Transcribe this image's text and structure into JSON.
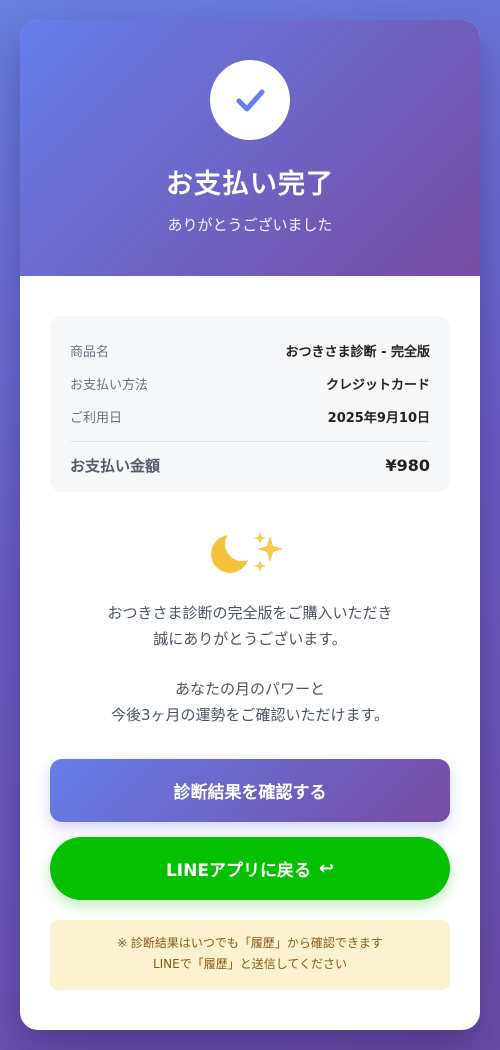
{
  "header": {
    "title": "お支払い完了",
    "subtitle": "ありがとうございました",
    "icon": "check-icon",
    "accent_color": "#667eea"
  },
  "summary": {
    "rows": [
      {
        "label": "商品名",
        "value": "おつきさま診断 - 完全版"
      },
      {
        "label": "お支払い方法",
        "value": "クレジットカード"
      },
      {
        "label": "ご利用日",
        "value": "2025年9月10日"
      }
    ],
    "total_label": "お支払い金額",
    "total_value": "¥980"
  },
  "decoration": {
    "emoji": "🌙✨"
  },
  "message": {
    "line1": "おつきさま診断の完全版をご購入いただき",
    "line2": "誠にありがとうございます。",
    "line3": "あなたの月のパワーと",
    "line4": "今後3ヶ月の運勢をご確認いただけます。"
  },
  "buttons": {
    "primary_label": "診断結果を確認する",
    "line_label": "LINEアプリに戻る",
    "line_icon": "↩",
    "line_color": "#06c102"
  },
  "notice": {
    "line1": "※ 診断結果はいつでも「履歴」から確認できます",
    "line2": "LINEで「履歴」と送信してください"
  }
}
